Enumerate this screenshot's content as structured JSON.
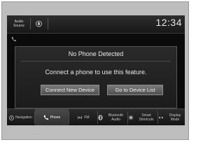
{
  "status_bar": {
    "audio_source_label": "Audio Source",
    "clock": "12:34"
  },
  "dialog": {
    "title": "No Phone Detected",
    "message": "Connect a phone to use this feature.",
    "connect_button": "Connect New Device",
    "list_button": "Go to Device List"
  },
  "nav": {
    "items": [
      {
        "label": "Navigation",
        "icon": "navigation-icon"
      },
      {
        "label": "Phone",
        "icon": "phone-icon"
      },
      {
        "label": "FM",
        "icon": "radio-icon"
      },
      {
        "label": "Bluetooth Audio",
        "icon": "bluetooth-icon"
      },
      {
        "label": "Smart Shortcuts",
        "icon": "smart-shortcuts-icon"
      },
      {
        "label": "Display Mode",
        "icon": "display-mode-icon"
      }
    ],
    "active_index": 1
  },
  "colors": {
    "screen_bg": "#0b0b0b",
    "button_bg": "#6a6a6a",
    "text": "#e8e8e8"
  }
}
